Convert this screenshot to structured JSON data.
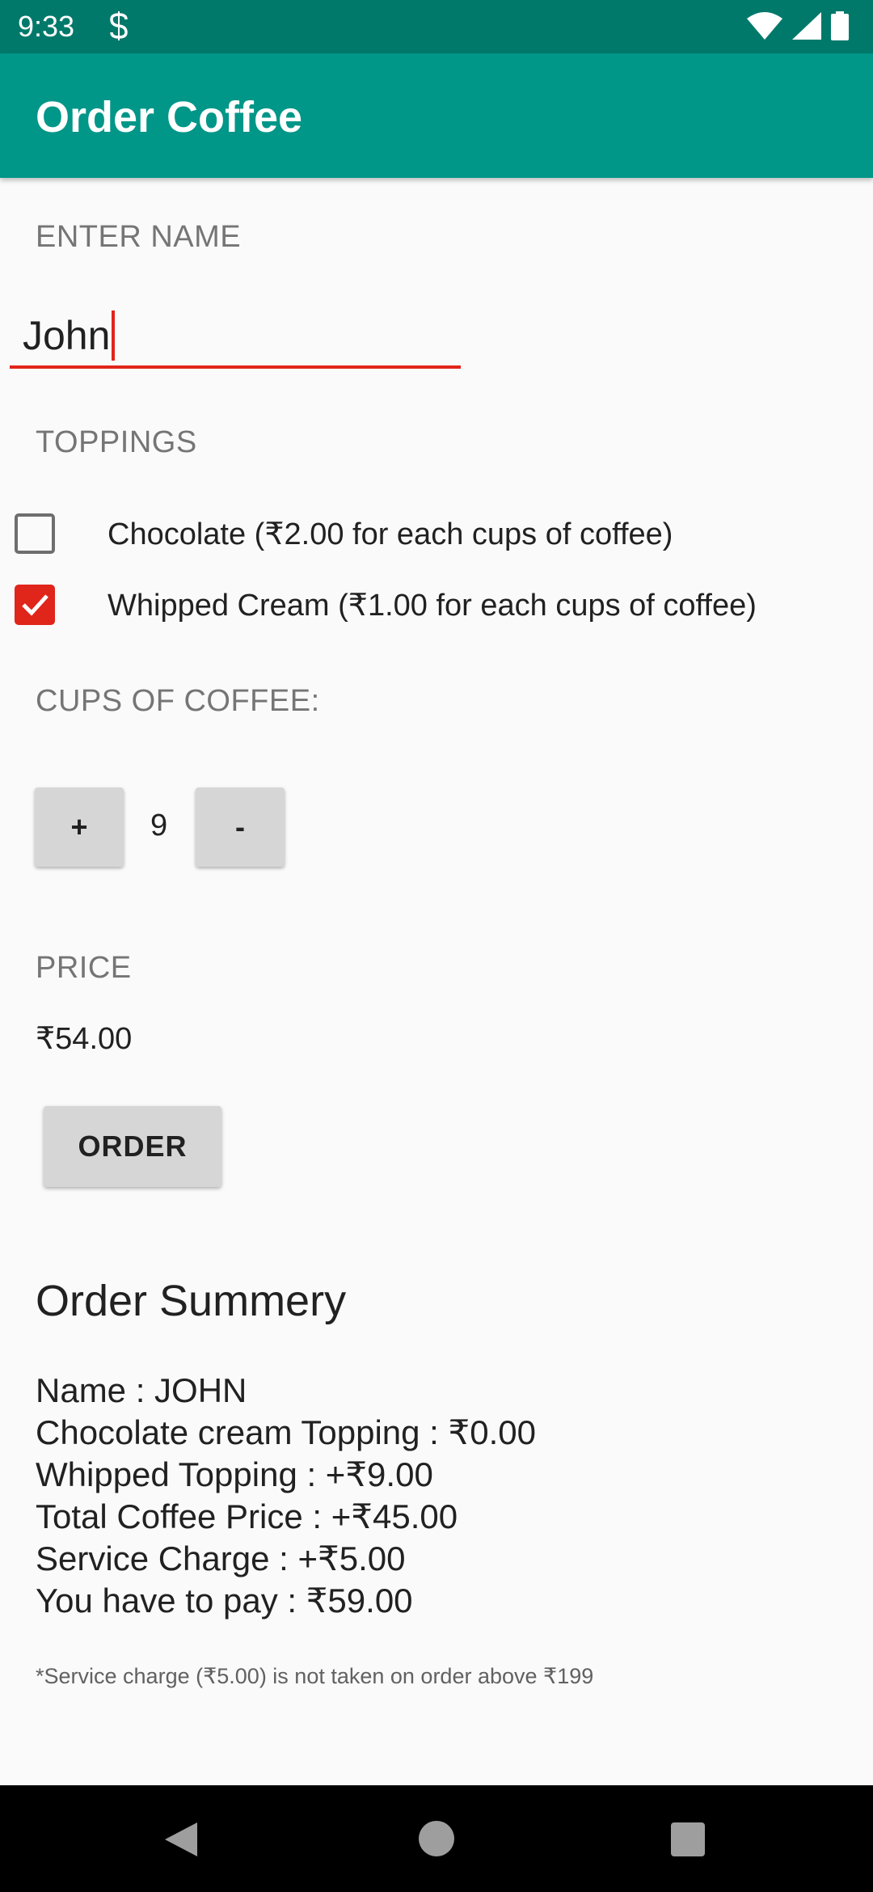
{
  "status_bar": {
    "time": "9:33"
  },
  "app_bar": {
    "title": "Order Coffee"
  },
  "name_section": {
    "label": "ENTER NAME",
    "value": "John"
  },
  "toppings": {
    "label": "TOPPINGS",
    "items": [
      {
        "label": "Chocolate (₹2.00 for each cups of coffee)",
        "checked": false
      },
      {
        "label": "Whipped Cream (₹1.00 for each cups of coffee)",
        "checked": true
      }
    ]
  },
  "quantity": {
    "label": "CUPS OF COFFEE:",
    "plus": "+",
    "value": "9",
    "minus": "-"
  },
  "price": {
    "label": "PRICE",
    "value": "₹54.00"
  },
  "order_button": {
    "label": "ORDER"
  },
  "summary": {
    "title": "Order Summery",
    "lines": [
      "Name : JOHN",
      "Chocolate cream Topping : ₹0.00",
      "Whipped Topping : +₹9.00",
      "Total Coffee Price : +₹45.00",
      "Service Charge : +₹5.00",
      "You have to pay : ₹59.00"
    ],
    "footnote": "*Service charge (₹5.00) is not taken on order above ₹199"
  },
  "colors": {
    "status_bar": "#00796b",
    "app_bar": "#009688",
    "accent": "#e0251b"
  }
}
